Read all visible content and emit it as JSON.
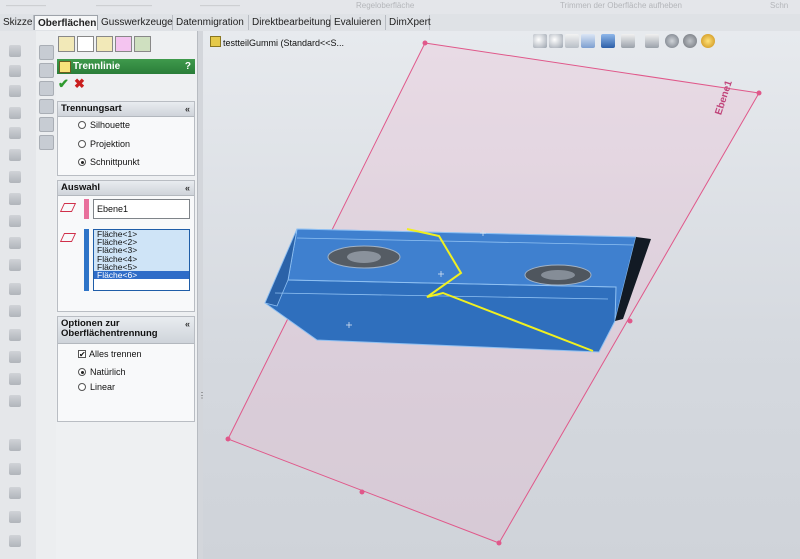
{
  "top_strip": {
    "ghost_left": [
      "—————",
      "———————",
      "—————"
    ],
    "ghost_1": "Regeloberfläche",
    "ghost_2": "Trimmen der Oberfläche aufheben",
    "ghost_3": "Schn"
  },
  "tabs": [
    {
      "label": "Skizze"
    },
    {
      "label": "Oberflächen"
    },
    {
      "label": "Gusswerkzeuge"
    },
    {
      "label": "Datenmigration"
    },
    {
      "label": "Direktbearbeitung"
    },
    {
      "label": "Evaluieren"
    },
    {
      "label": "DimXpert"
    }
  ],
  "feature": {
    "title": "Trennlinie",
    "help": "?",
    "ok": "✔",
    "cancel": "✖"
  },
  "trennungsart": {
    "title": "Trennungsart",
    "options": [
      "Silhouette",
      "Projektion",
      "Schnittpunkt"
    ],
    "selected": "Schnittpunkt"
  },
  "auswahl": {
    "title": "Auswahl",
    "plane": "Ebene1",
    "faces": [
      "Fläche<1>",
      "Fläche<2>",
      "Fläche<3>",
      "Fläche<4>",
      "Fläche<5>",
      "Fläche<6>"
    ],
    "selected_face": "Fläche<6>"
  },
  "optionen": {
    "title_line1": "Optionen zur",
    "title_line2": "Oberflächentrennung",
    "alles_trennen": "Alles trennen",
    "alles_trennen_checked": true,
    "modes": [
      "Natürlich",
      "Linear"
    ],
    "selected_mode": "Natürlich",
    "chevron": "«"
  },
  "tree": {
    "label": "testteilGummi  (Standard<<S..."
  },
  "plane_label": "Ebene1",
  "colors": {
    "part_blue": "#2f6fbd",
    "part_top": "#4a8ad6",
    "plane_pink": "#e0588a",
    "split_line": "#f0f020",
    "feature_green": "#2a7d39"
  }
}
